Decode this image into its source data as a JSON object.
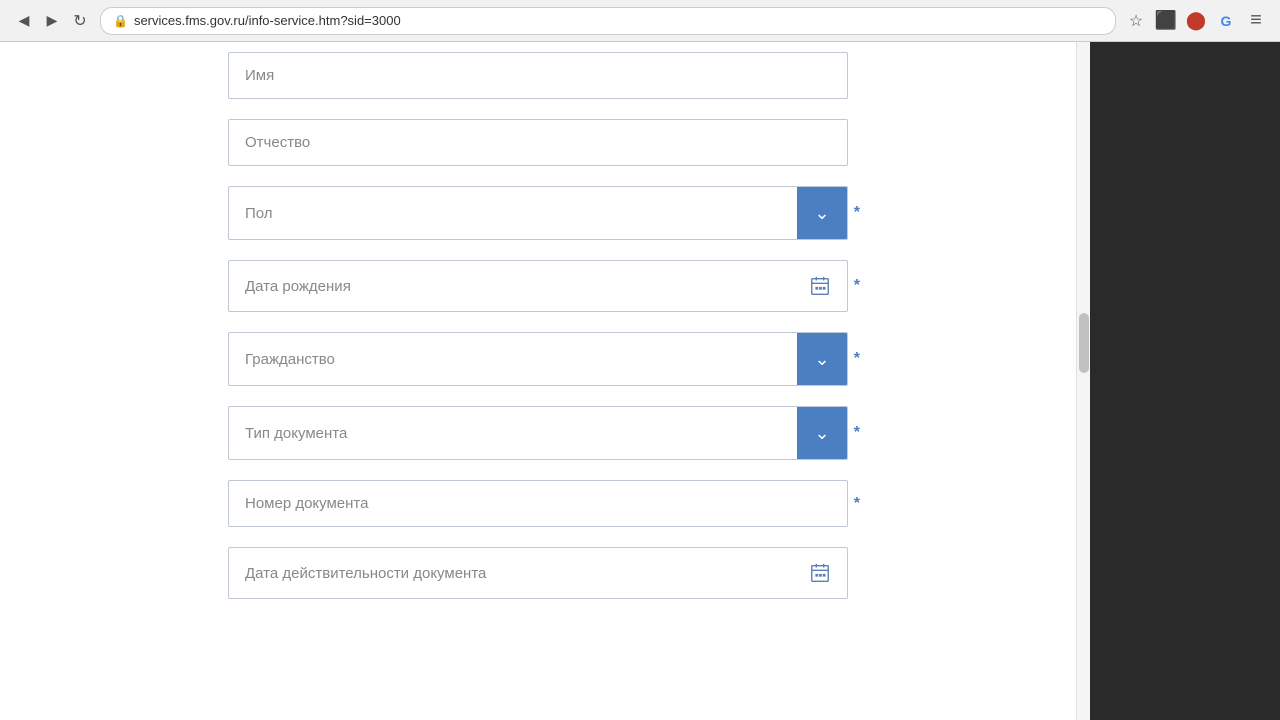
{
  "browser": {
    "url": "services.fms.gov.ru/info-service.htm?sid=3000",
    "nav": {
      "back_label": "◀",
      "forward_label": "▶",
      "reload_label": "↻"
    },
    "actions": {
      "star": "☆",
      "menu1": "⬛",
      "menu2": "O",
      "ext": "G",
      "hamburger": "≡"
    }
  },
  "form": {
    "fields": [
      {
        "id": "imya",
        "type": "text",
        "placeholder": "Имя",
        "required": false,
        "value": ""
      },
      {
        "id": "otchestvo",
        "type": "text",
        "placeholder": "Отчество",
        "required": false,
        "value": ""
      },
      {
        "id": "pol",
        "type": "select",
        "placeholder": "Пол",
        "required": true,
        "value": ""
      },
      {
        "id": "data_rozhdeniya",
        "type": "date",
        "placeholder": "Дата рождения",
        "required": true,
        "value": ""
      },
      {
        "id": "grazhdanstvo",
        "type": "select",
        "placeholder": "Гражданство",
        "required": true,
        "value": ""
      },
      {
        "id": "tip_dokumenta",
        "type": "select",
        "placeholder": "Тип документа",
        "required": true,
        "value": ""
      },
      {
        "id": "nomer_dokumenta",
        "type": "text",
        "placeholder": "Номер документа",
        "required": true,
        "value": ""
      },
      {
        "id": "data_deystvitelnosti",
        "type": "date",
        "placeholder": "Дата действительности документа",
        "required": false,
        "value": ""
      }
    ]
  }
}
